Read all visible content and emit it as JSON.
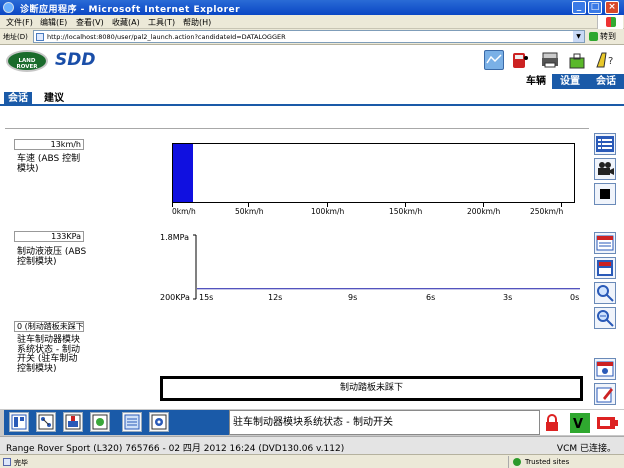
{
  "window": {
    "title": "诊断应用程序 - Microsoft Internet Explorer",
    "min": "_",
    "max": "□",
    "close": "×"
  },
  "menu": [
    "文件(F)",
    "编辑(E)",
    "查看(V)",
    "收藏(A)",
    "工具(T)",
    "帮助(H)"
  ],
  "address": {
    "label": "地址(D)",
    "url": "http://localhost:8080/user/pal2_launch.action?candidateId=DATALOGGER",
    "go": "转到"
  },
  "header": {
    "brand_logo": "LAND ROVER",
    "app_logo": "SDD",
    "tabs": [
      {
        "label": "车辆",
        "active": true
      },
      {
        "label": "设置",
        "active": false
      },
      {
        "label": "会话",
        "active": false
      }
    ]
  },
  "subtabs": [
    {
      "label": "会话",
      "selected": true
    },
    {
      "label": "建议",
      "selected": false
    }
  ],
  "panels": {
    "speed": {
      "readout": "13km/h",
      "label": "车速 (ABS 控制模块)",
      "bar_fill_fraction": 0.05,
      "ticks": [
        "0km/h",
        "50km/h",
        "100km/h",
        "150km/h",
        "200km/h",
        "250km/h"
      ]
    },
    "pressure": {
      "readout": "133KPa",
      "label": "制动液液压 (ABS 控制模块)",
      "y_top": "1.8MPa",
      "y_bottom": "200KPa",
      "x_ticks": [
        "15s",
        "12s",
        "9s",
        "6s",
        "3s",
        "0s"
      ]
    },
    "brake_switch": {
      "readout": "0 (制动踏板未踩下)",
      "label": "驻车制动器模块系统状态 - 制动开关 (驻车制动控制模块)",
      "status_text": "制动踏板未踩下"
    }
  },
  "chart_data": [
    {
      "type": "bar",
      "categories": [
        "车速 (ABS 控制模块)"
      ],
      "values": [
        13
      ],
      "xlim": [
        0,
        260
      ],
      "ticks": [
        "0km/h",
        "50km/h",
        "100km/h",
        "150km/h",
        "200km/h",
        "250km/h"
      ]
    },
    {
      "type": "line",
      "x": [
        15,
        12,
        9,
        6,
        3,
        0
      ],
      "values": [
        133,
        133,
        133,
        133,
        133,
        133
      ],
      "y_top_label": "1.8MPa",
      "y_bottom_label": "200KPa"
    }
  ],
  "bottom": {
    "status_text": "驻车制动器模块系统状态 - 制动开关"
  },
  "vehicle_info": {
    "left": "Range Rover Sport (L320) 765766 - 02 四月 2012 16:24 (DVD130.06 v.112)",
    "right": "VCM 已连接。"
  },
  "ie_status": {
    "left": "完毕",
    "zone": "Trusted sites"
  }
}
